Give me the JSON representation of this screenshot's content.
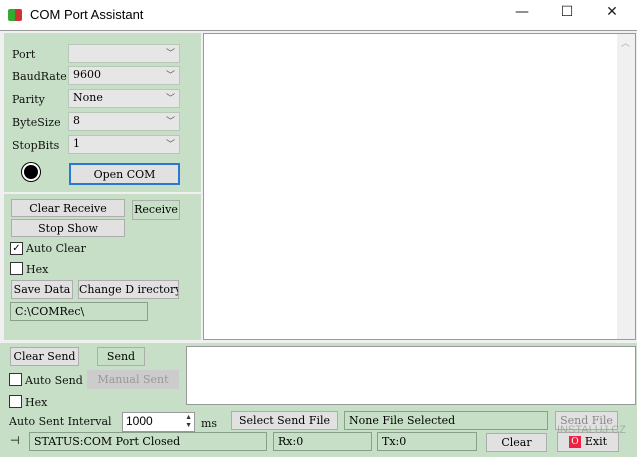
{
  "window": {
    "title": "COM Port Assistant",
    "minimize": "—",
    "maximize": "☐",
    "close": "✕"
  },
  "settings": {
    "port": {
      "label": "Port",
      "value": ""
    },
    "baud": {
      "label": "BaudRate",
      "value": "9600"
    },
    "parity": {
      "label": "Parity",
      "value": "None"
    },
    "bytesize": {
      "label": "ByteSize",
      "value": "8"
    },
    "stopbits": {
      "label": "StopBits",
      "value": "1"
    },
    "open_label": "Open COM"
  },
  "receive": {
    "clear_label": "Clear Receive",
    "receive_label": "Receive",
    "stop_label": "Stop Show",
    "auto_clear": "Auto Clear",
    "auto_clear_checked": true,
    "hex": "Hex",
    "save_label": "Save Data",
    "change_dir_label": "Change D irectory",
    "directory": "C:\\COMRec\\",
    "content": ""
  },
  "send": {
    "clear_label": "Clear Send",
    "send_label": "Send",
    "auto_send": "Auto Send",
    "manual_label": "Manual Sent",
    "hex": "Hex",
    "interval_label": "Auto Sent Interval",
    "interval": "1000",
    "ms": "ms",
    "select_file_label": "Select Send File",
    "file": "None File Selected",
    "send_file_label": "Send File",
    "content": ""
  },
  "status": {
    "text": "STATUS:COM Port Closed",
    "rx": "Rx:0",
    "tx": "Tx:0",
    "clear_label": "Clear",
    "exit_label": "Exit"
  },
  "watermark": "INSTALUJ.CZ"
}
